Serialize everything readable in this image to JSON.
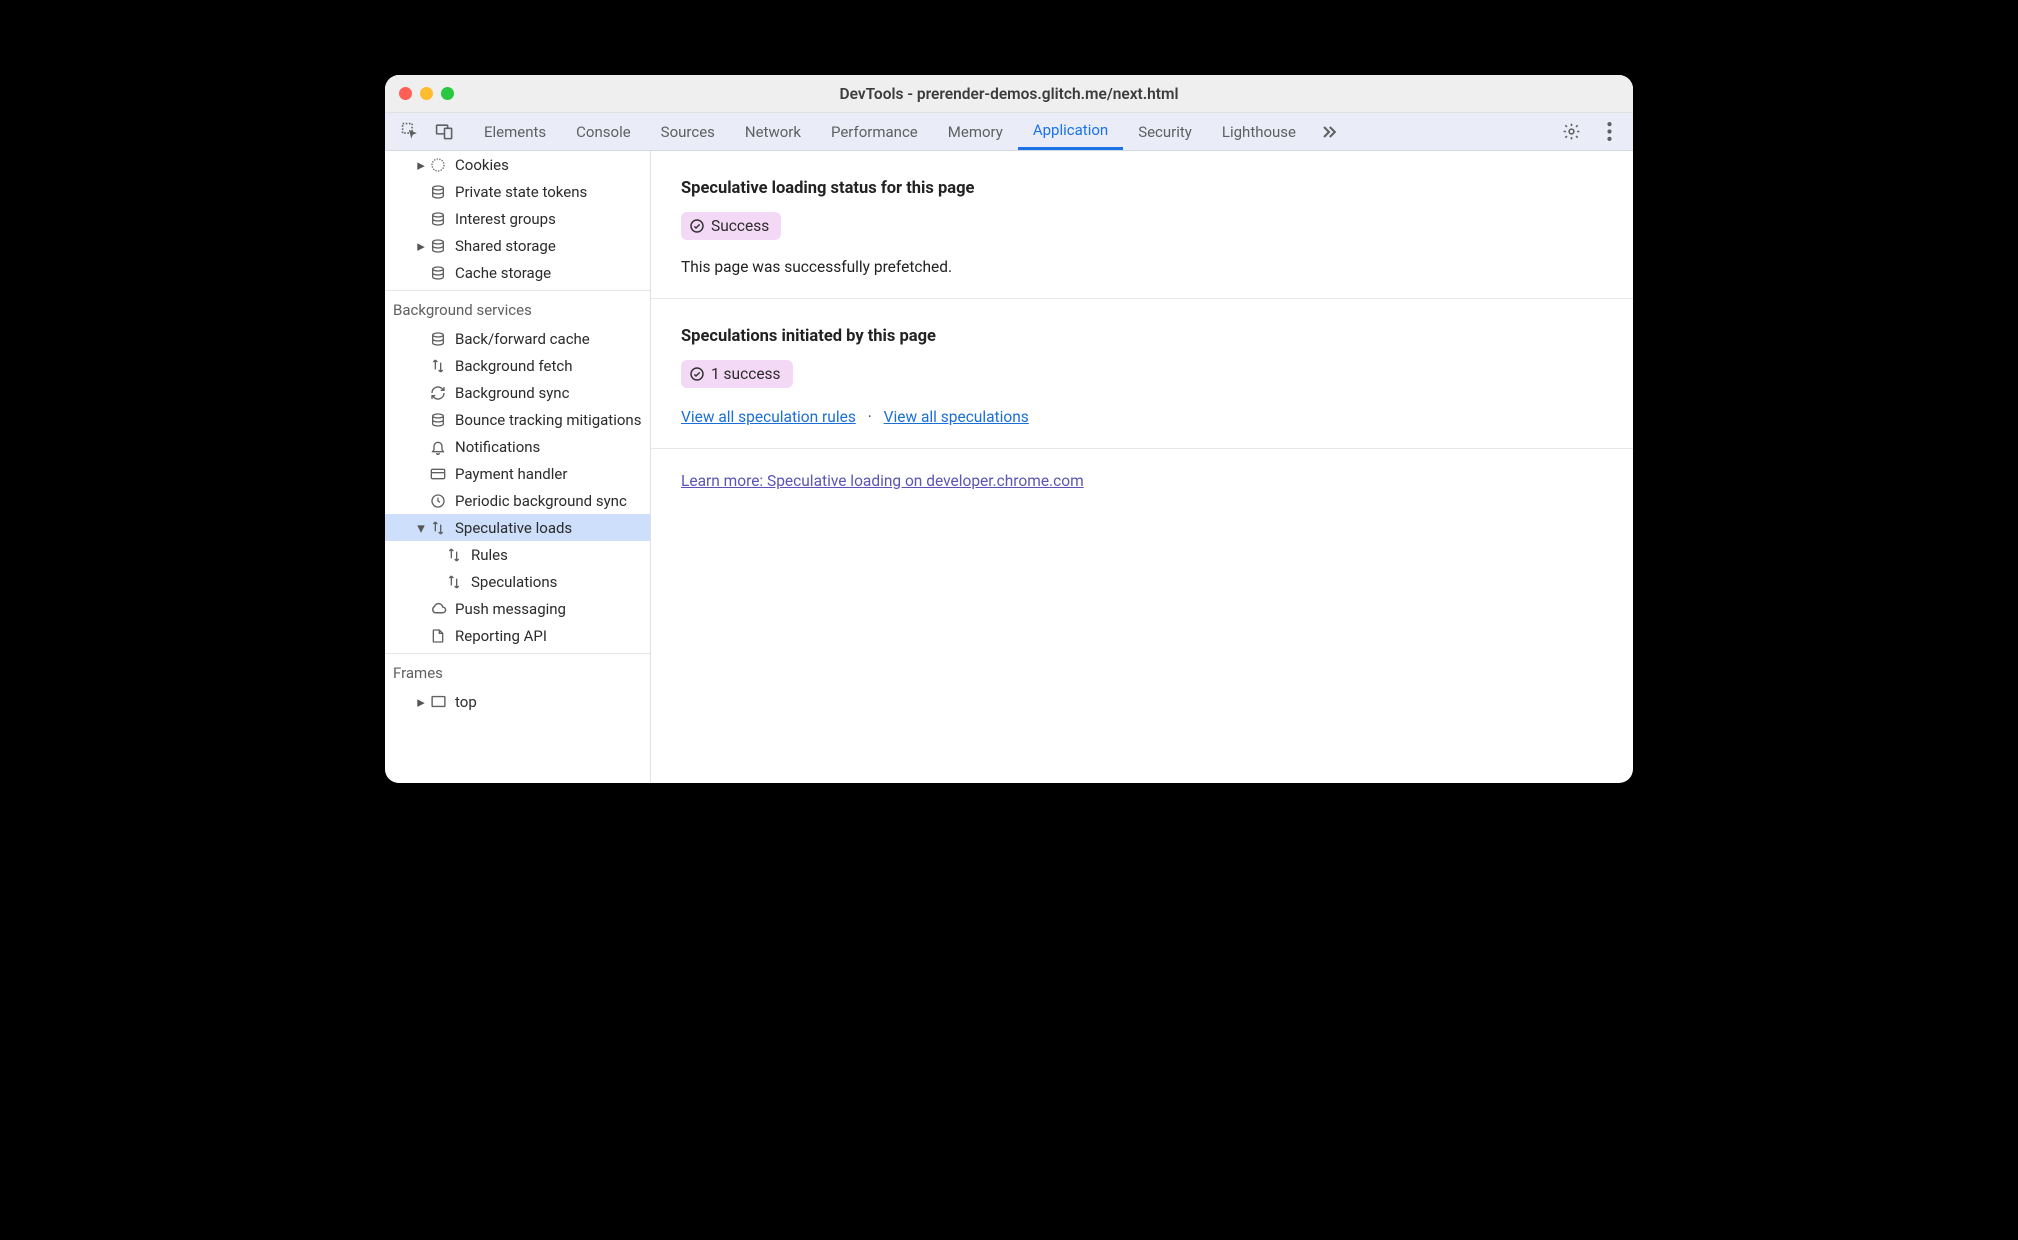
{
  "window": {
    "title": "DevTools - prerender-demos.glitch.me/next.html"
  },
  "tabs": [
    "Elements",
    "Console",
    "Sources",
    "Network",
    "Performance",
    "Memory",
    "Application",
    "Security",
    "Lighthouse"
  ],
  "tabs_active_index": 6,
  "sidebar": {
    "storage_items": [
      {
        "label": "Cookies",
        "icon": "cookie",
        "expandable": true
      },
      {
        "label": "Private state tokens",
        "icon": "db"
      },
      {
        "label": "Interest groups",
        "icon": "db"
      },
      {
        "label": "Shared storage",
        "icon": "db",
        "expandable": true
      },
      {
        "label": "Cache storage",
        "icon": "db"
      }
    ],
    "bg_title": "Background services",
    "bg_items": [
      {
        "label": "Back/forward cache",
        "icon": "db"
      },
      {
        "label": "Background fetch",
        "icon": "arrows"
      },
      {
        "label": "Background sync",
        "icon": "sync"
      },
      {
        "label": "Bounce tracking mitigations",
        "icon": "db"
      },
      {
        "label": "Notifications",
        "icon": "bell"
      },
      {
        "label": "Payment handler",
        "icon": "card"
      },
      {
        "label": "Periodic background sync",
        "icon": "clock"
      },
      {
        "label": "Speculative loads",
        "icon": "arrows",
        "expandable": true,
        "expanded": true,
        "selected": true,
        "children": [
          {
            "label": "Rules",
            "icon": "arrows"
          },
          {
            "label": "Speculations",
            "icon": "arrows"
          }
        ]
      },
      {
        "label": "Push messaging",
        "icon": "cloud"
      },
      {
        "label": "Reporting API",
        "icon": "doc"
      }
    ],
    "frames_title": "Frames",
    "frames_items": [
      {
        "label": "top",
        "icon": "frame",
        "expandable": true
      }
    ]
  },
  "content": {
    "status_heading": "Speculative loading status for this page",
    "status_badge": "Success",
    "status_desc": "This page was successfully prefetched.",
    "spec_heading": "Speculations initiated by this page",
    "spec_badge": "1 success",
    "link_rules": "View all speculation rules",
    "link_specs": "View all speculations",
    "learn_more": "Learn more: Speculative loading on developer.chrome.com"
  }
}
